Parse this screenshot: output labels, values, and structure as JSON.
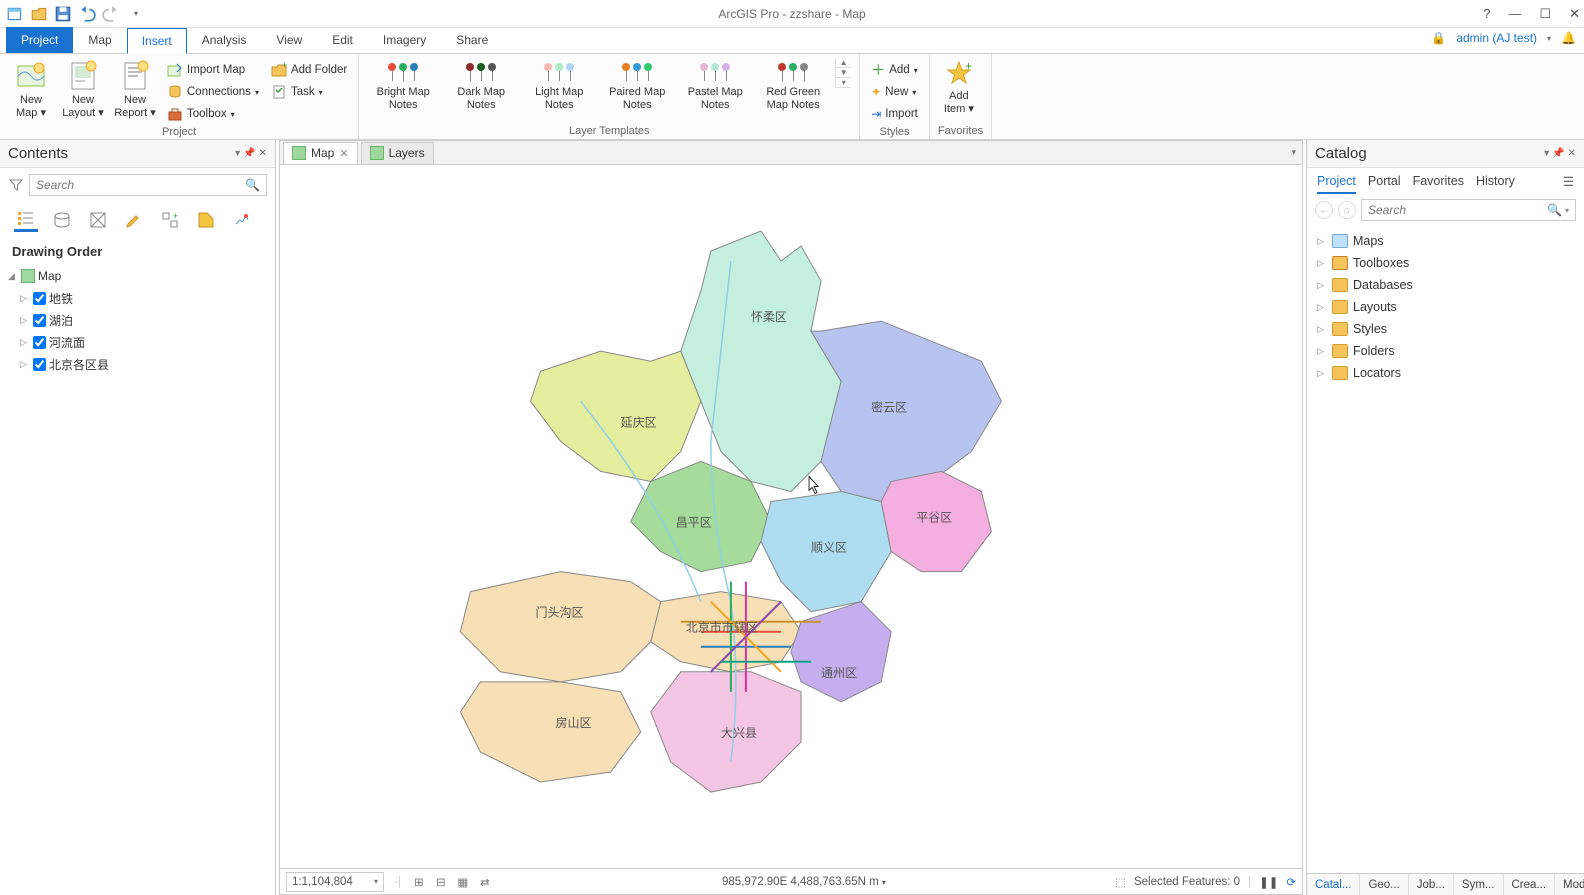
{
  "titlebar": {
    "title": "ArcGIS Pro - zzshare - Map"
  },
  "user": {
    "name": "admin (AJ test)"
  },
  "ribbon_tabs": {
    "project": "Project",
    "map": "Map",
    "insert": "Insert",
    "analysis": "Analysis",
    "view": "View",
    "edit": "Edit",
    "imagery": "Imagery",
    "share": "Share"
  },
  "ribbon": {
    "project": {
      "label": "Project",
      "new_map": "New Map",
      "new_layout": "New Layout",
      "new_report": "New Report",
      "import_map": "Import Map",
      "connections": "Connections",
      "toolbox": "Toolbox",
      "add_folder": "Add Folder",
      "task": "Task"
    },
    "templates": {
      "label": "Layer Templates",
      "bright": "Bright Map Notes",
      "dark": "Dark Map Notes",
      "light": "Light Map Notes",
      "paired": "Paired Map Notes",
      "pastel": "Pastel Map Notes",
      "redgreen": "Red Green Map Notes"
    },
    "styles": {
      "label": "Styles",
      "add": "Add",
      "new": "New",
      "import": "Import"
    },
    "favorites": {
      "label": "Favorites",
      "add_item": "Add Item"
    }
  },
  "contents": {
    "title": "Contents",
    "search_placeholder": "Search",
    "heading": "Drawing Order",
    "root": "Map",
    "layers": [
      "地铁",
      "湖泊",
      "河流面",
      "北京各区县"
    ]
  },
  "map_tabs": {
    "map": "Map",
    "layers": "Layers"
  },
  "map": {
    "scale": "1:1,104,804",
    "coords": "985,972.90E 4,488,763.65N m",
    "selected": "Selected Features: 0",
    "regions": {
      "huairou": "怀柔区",
      "miyun": "密云区",
      "yanqing": "延庆区",
      "changping": "昌平区",
      "shunyi": "顺义区",
      "pinggu": "平谷区",
      "mentougou": "门头沟区",
      "beijing_center": "北京市市辖区",
      "tongzhou": "通州区",
      "fangshan": "房山区",
      "daxing": "大兴县"
    }
  },
  "catalog": {
    "title": "Catalog",
    "tabs": {
      "project": "Project",
      "portal": "Portal",
      "favorites": "Favorites",
      "history": "History"
    },
    "search_placeholder": "Search",
    "items": [
      "Maps",
      "Toolboxes",
      "Databases",
      "Layouts",
      "Styles",
      "Folders",
      "Locators"
    ]
  },
  "bottom_tabs": [
    "Catal...",
    "Geo...",
    "Job...",
    "Sym...",
    "Crea...",
    "Mod..."
  ]
}
